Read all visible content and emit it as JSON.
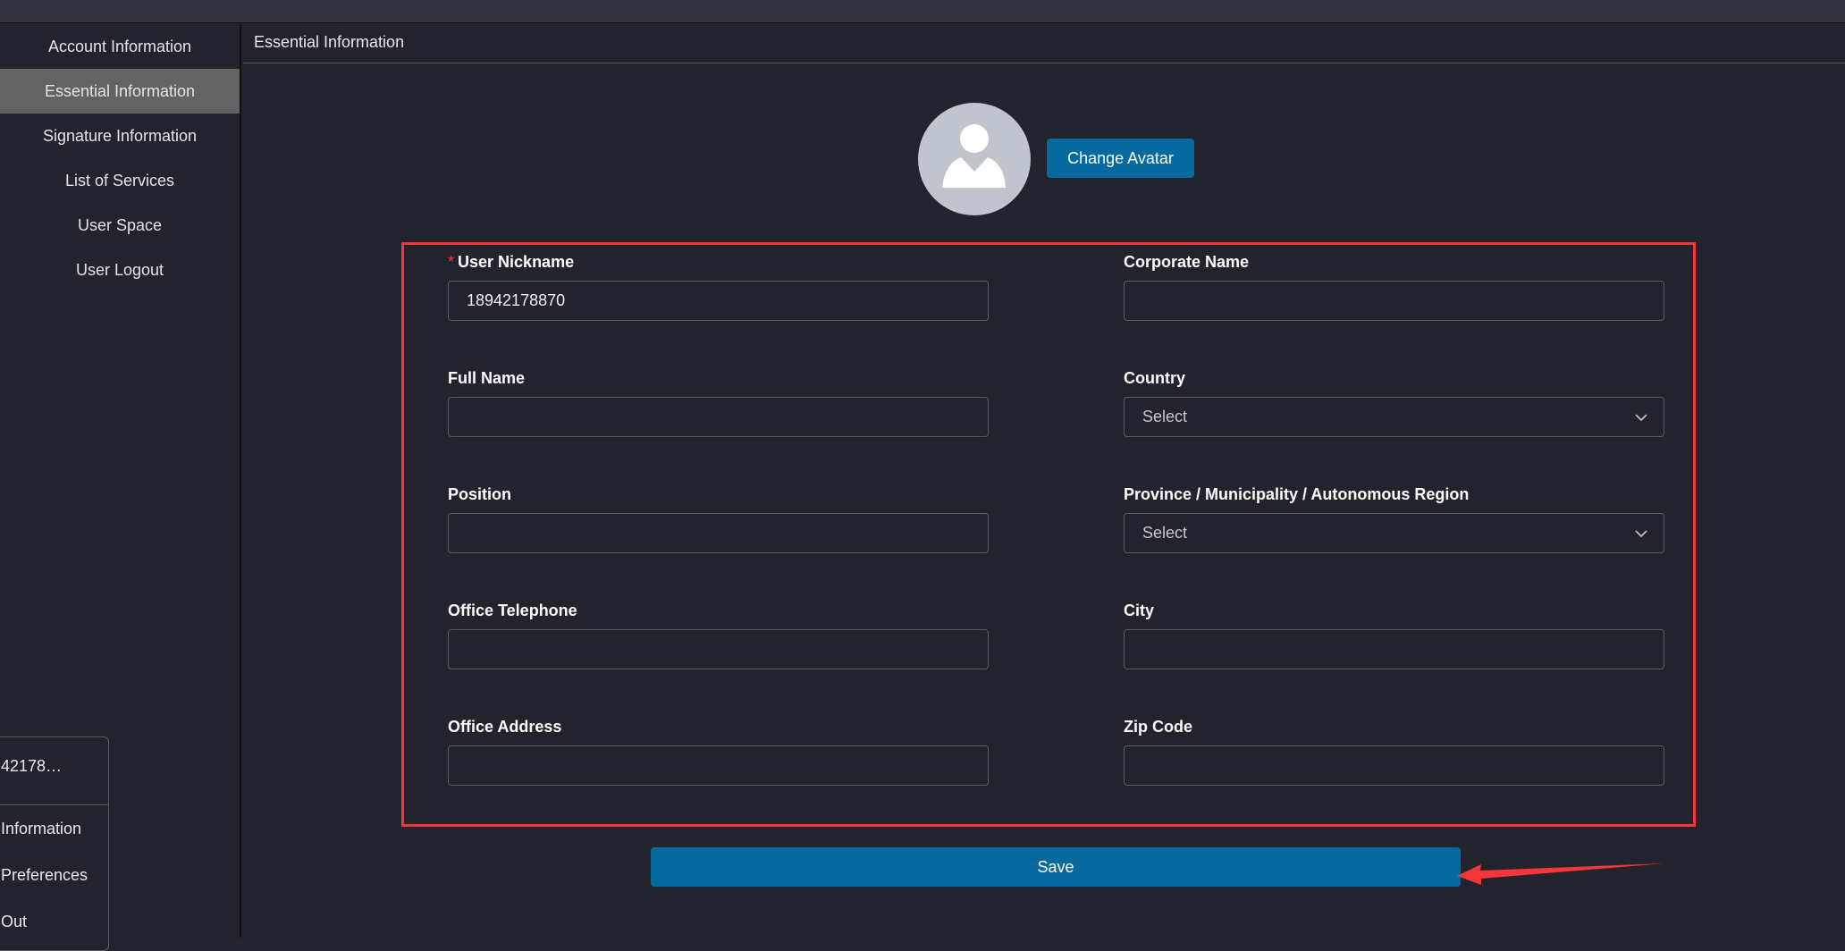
{
  "sidebar": {
    "items": [
      {
        "label": "Account Information",
        "active": false
      },
      {
        "label": "Essential Information",
        "active": true
      },
      {
        "label": "Signature Information",
        "active": false
      },
      {
        "label": "List of Services",
        "active": false
      },
      {
        "label": "User Space",
        "active": false
      },
      {
        "label": "User Logout",
        "active": false
      }
    ]
  },
  "header": {
    "title": "Essential Information"
  },
  "avatar": {
    "icon": "user-placeholder-icon",
    "change_label": "Change Avatar"
  },
  "form": {
    "left": [
      {
        "label": "User Nickname",
        "required": true,
        "value": "18942178870",
        "type": "text"
      },
      {
        "label": "Full Name",
        "value": "",
        "type": "text"
      },
      {
        "label": "Position",
        "value": "",
        "type": "text"
      },
      {
        "label": "Office Telephone",
        "value": "",
        "type": "text"
      },
      {
        "label": "Office Address",
        "value": "",
        "type": "text"
      }
    ],
    "right": [
      {
        "label": "Corporate Name",
        "value": "",
        "type": "text"
      },
      {
        "label": "Country",
        "value": "Select",
        "type": "select"
      },
      {
        "label": "Province / Municipality / Autonomous Region",
        "value": "Select",
        "type": "select"
      },
      {
        "label": "City",
        "value": "",
        "type": "text"
      },
      {
        "label": "Zip Code",
        "value": "",
        "type": "text"
      }
    ],
    "required_mark": "*",
    "save_label": "Save"
  },
  "popup": {
    "user": "42178…",
    "items": [
      "Information",
      "Preferences",
      "Out"
    ]
  },
  "colors": {
    "accent": "#06699f",
    "annotation": "#f5363a",
    "active_item": "#636363",
    "background": "#23232d"
  }
}
